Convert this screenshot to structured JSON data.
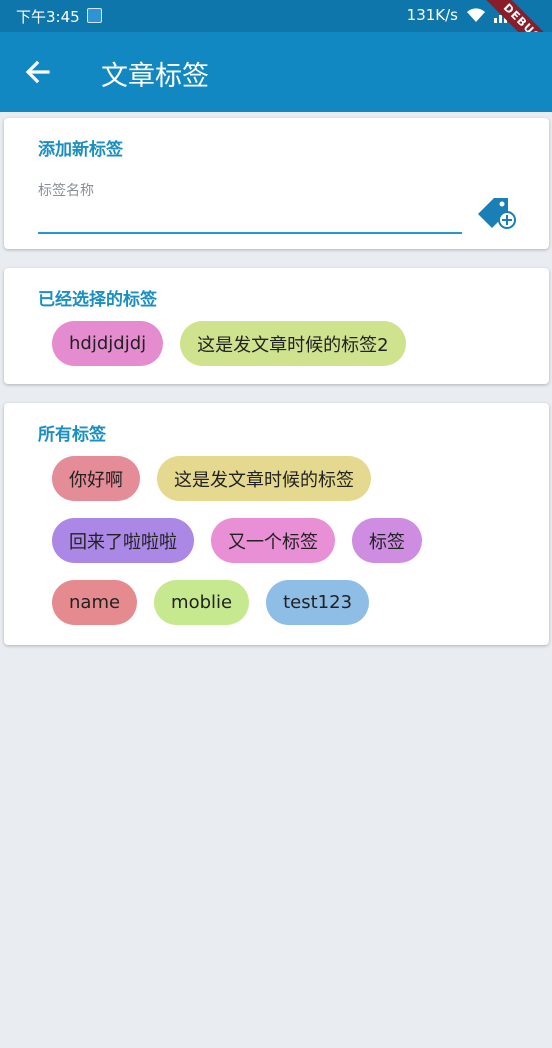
{
  "status_bar": {
    "time": "下午3:45",
    "network_speed": "131K/s",
    "debug_banner": "DEBUG"
  },
  "app_bar": {
    "title": "文章标签",
    "back_icon": "arrow-back-icon"
  },
  "add_section": {
    "title": "添加新标签",
    "field_label": "标签名称",
    "field_value": "",
    "add_icon": "tag-add-icon"
  },
  "selected_section": {
    "title": "已经选择的标签",
    "tags": [
      {
        "label": "hdjdjdjdj",
        "color": "#e58bd0"
      },
      {
        "label": "这是发文章时候的标签2",
        "color": "#cfe38f"
      }
    ]
  },
  "all_section": {
    "title": "所有标签",
    "tags": [
      {
        "label": "你好啊",
        "color": "#e48c97"
      },
      {
        "label": "这是发文章时候的标签",
        "color": "#e5d88f"
      },
      {
        "label": "回来了啦啦啦",
        "color": "#ab87e6"
      },
      {
        "label": "又一个标签",
        "color": "#e98fd6"
      },
      {
        "label": "标签",
        "color": "#cf8de2"
      },
      {
        "label": "name",
        "color": "#e58b8f"
      },
      {
        "label": "moblie",
        "color": "#c6e88f"
      },
      {
        "label": "test123",
        "color": "#8ebde6"
      }
    ]
  }
}
